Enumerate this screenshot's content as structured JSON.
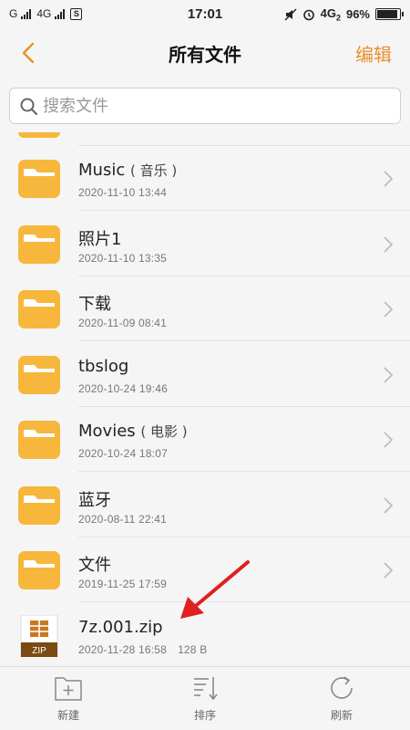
{
  "status_bar": {
    "carrier1": "G",
    "network": "4G",
    "sim": "S",
    "time": "17:01",
    "network_right": "4G",
    "network_right_sub": "2",
    "battery_percent": "96%",
    "battery_level": 0.96
  },
  "header": {
    "title": "所有文件",
    "edit_label": "编辑"
  },
  "search": {
    "placeholder": "搜索文件"
  },
  "files": [
    {
      "name": "Music",
      "sub": "( 音乐 )",
      "date": "2020-11-10 13:44",
      "type": "folder"
    },
    {
      "name": "照片1",
      "sub": "",
      "date": "2020-11-10 13:35",
      "type": "folder"
    },
    {
      "name": "下载",
      "sub": "",
      "date": "2020-11-09 08:41",
      "type": "folder"
    },
    {
      "name": "tbslog",
      "sub": "",
      "date": "2020-10-24 19:46",
      "type": "folder"
    },
    {
      "name": "Movies",
      "sub": "( 电影 )",
      "date": "2020-10-24 18:07",
      "type": "folder"
    },
    {
      "name": "蓝牙",
      "sub": "",
      "date": "2020-08-11 22:41",
      "type": "folder"
    },
    {
      "name": "文件",
      "sub": "",
      "date": "2019-11-25 17:59",
      "type": "folder"
    },
    {
      "name": "7z.001.zip",
      "sub": "",
      "date": "2020-11-28 16:58",
      "size": "128 B",
      "type": "zip",
      "badge": "ZIP"
    }
  ],
  "toolbar": {
    "new_label": "新建",
    "sort_label": "排序",
    "refresh_label": "刷新"
  },
  "colors": {
    "accent": "#e8912d",
    "folder": "#f6b73c",
    "arrow": "#e02020"
  }
}
